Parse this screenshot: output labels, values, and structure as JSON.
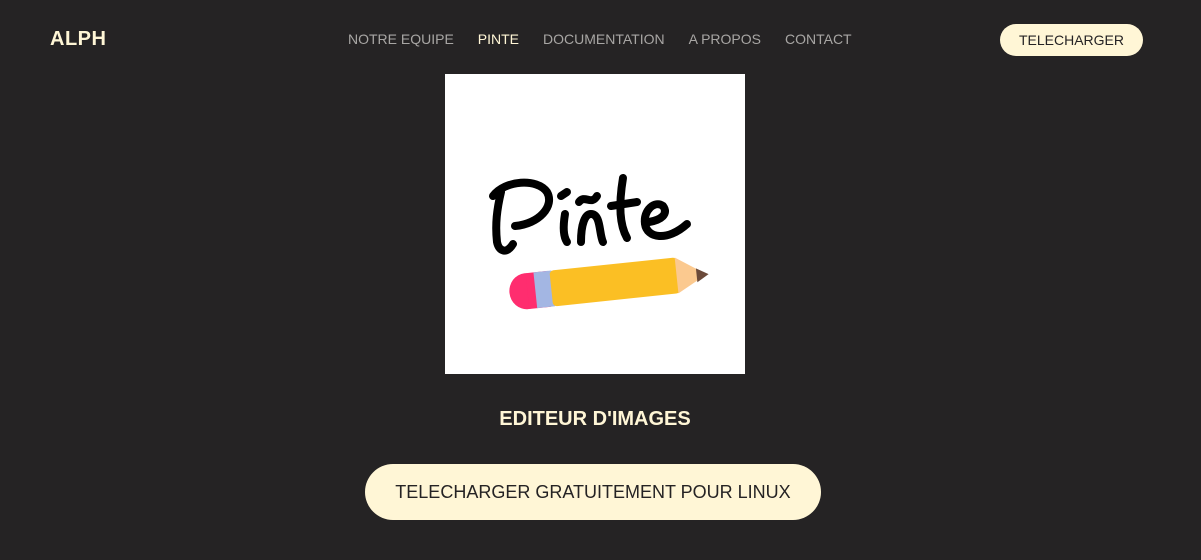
{
  "header": {
    "brand": "ALPH",
    "nav": [
      {
        "label": "NOTRE EQUIPE",
        "active": false
      },
      {
        "label": "PINTE",
        "active": true
      },
      {
        "label": "DOCUMENTATION",
        "active": false
      },
      {
        "label": "A PROPOS",
        "active": false
      },
      {
        "label": "CONTACT",
        "active": false
      }
    ],
    "download_label": "TELECHARGER"
  },
  "hero": {
    "logo_text": "Pinte",
    "subtitle": "EDITEUR D'IMAGES",
    "cta_label": "TELECHARGER GRATUITEMENT POUR LINUX"
  },
  "colors": {
    "background": "#252324",
    "accent": "#fff6d6",
    "nav_inactive": "#a8a6a4",
    "pencil_body": "#fbbf24",
    "pencil_eraser": "#ff2d6f",
    "pencil_band": "#a3b6e3",
    "pencil_wood": "#fbc98f"
  }
}
